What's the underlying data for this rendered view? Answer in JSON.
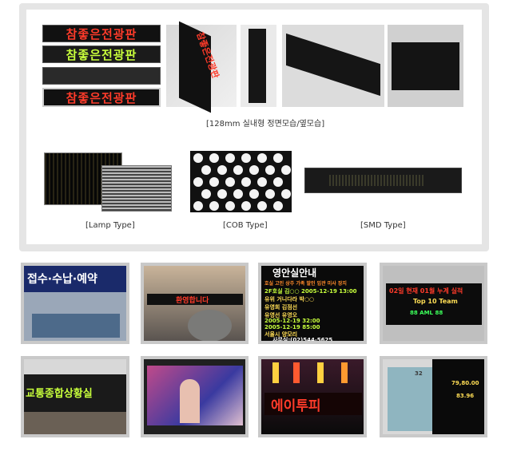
{
  "top_panel": {
    "led_signs": [
      {
        "text": "참좋은전광판",
        "color": "#ff3b2a"
      },
      {
        "text": "참좋은전광판",
        "color": "#c8ff3c"
      },
      {
        "text": "",
        "color": "#333333"
      },
      {
        "text": "참좋은전광판",
        "color": "#ff3b2a"
      }
    ],
    "caption_128mm": "[128mm 실내형 정면모습/옆모습]",
    "caption_lamp": "[Lamp Type]",
    "caption_cob": "[COB Type]",
    "caption_smd": "[SMD Type]"
  },
  "photos_row1": [
    {
      "text": "접수·수납·예약",
      "color": "#ffffff"
    },
    {
      "text": "환영합니다",
      "color": "#ff3b2a"
    },
    {
      "title": "영안실안내",
      "lines": [
        "호실 고인 상주 가족 발인 입관 미사 장지",
        "2F호실 김○○ 2005-12-19 13:00",
        "유위 거니다라 박○○",
        "유영희 김점선",
        "유영선 유영오",
        "2005-12-19 32:00",
        "2005-12-19 85:00",
        "서울시 양모리"
      ],
      "footer": "사무실:(02)544-5625"
    },
    {
      "line1": "02일 현재 01월 누계 실적",
      "line2": "Top 10 Team",
      "line3": "88   AML   88"
    }
  ],
  "photos_row2": [
    {
      "text": "교통종합상황실"
    },
    {
      "text": ""
    },
    {
      "text": "에이투피"
    },
    {
      "lines": [
        "32",
        "79,80.00",
        "83.96"
      ]
    }
  ]
}
